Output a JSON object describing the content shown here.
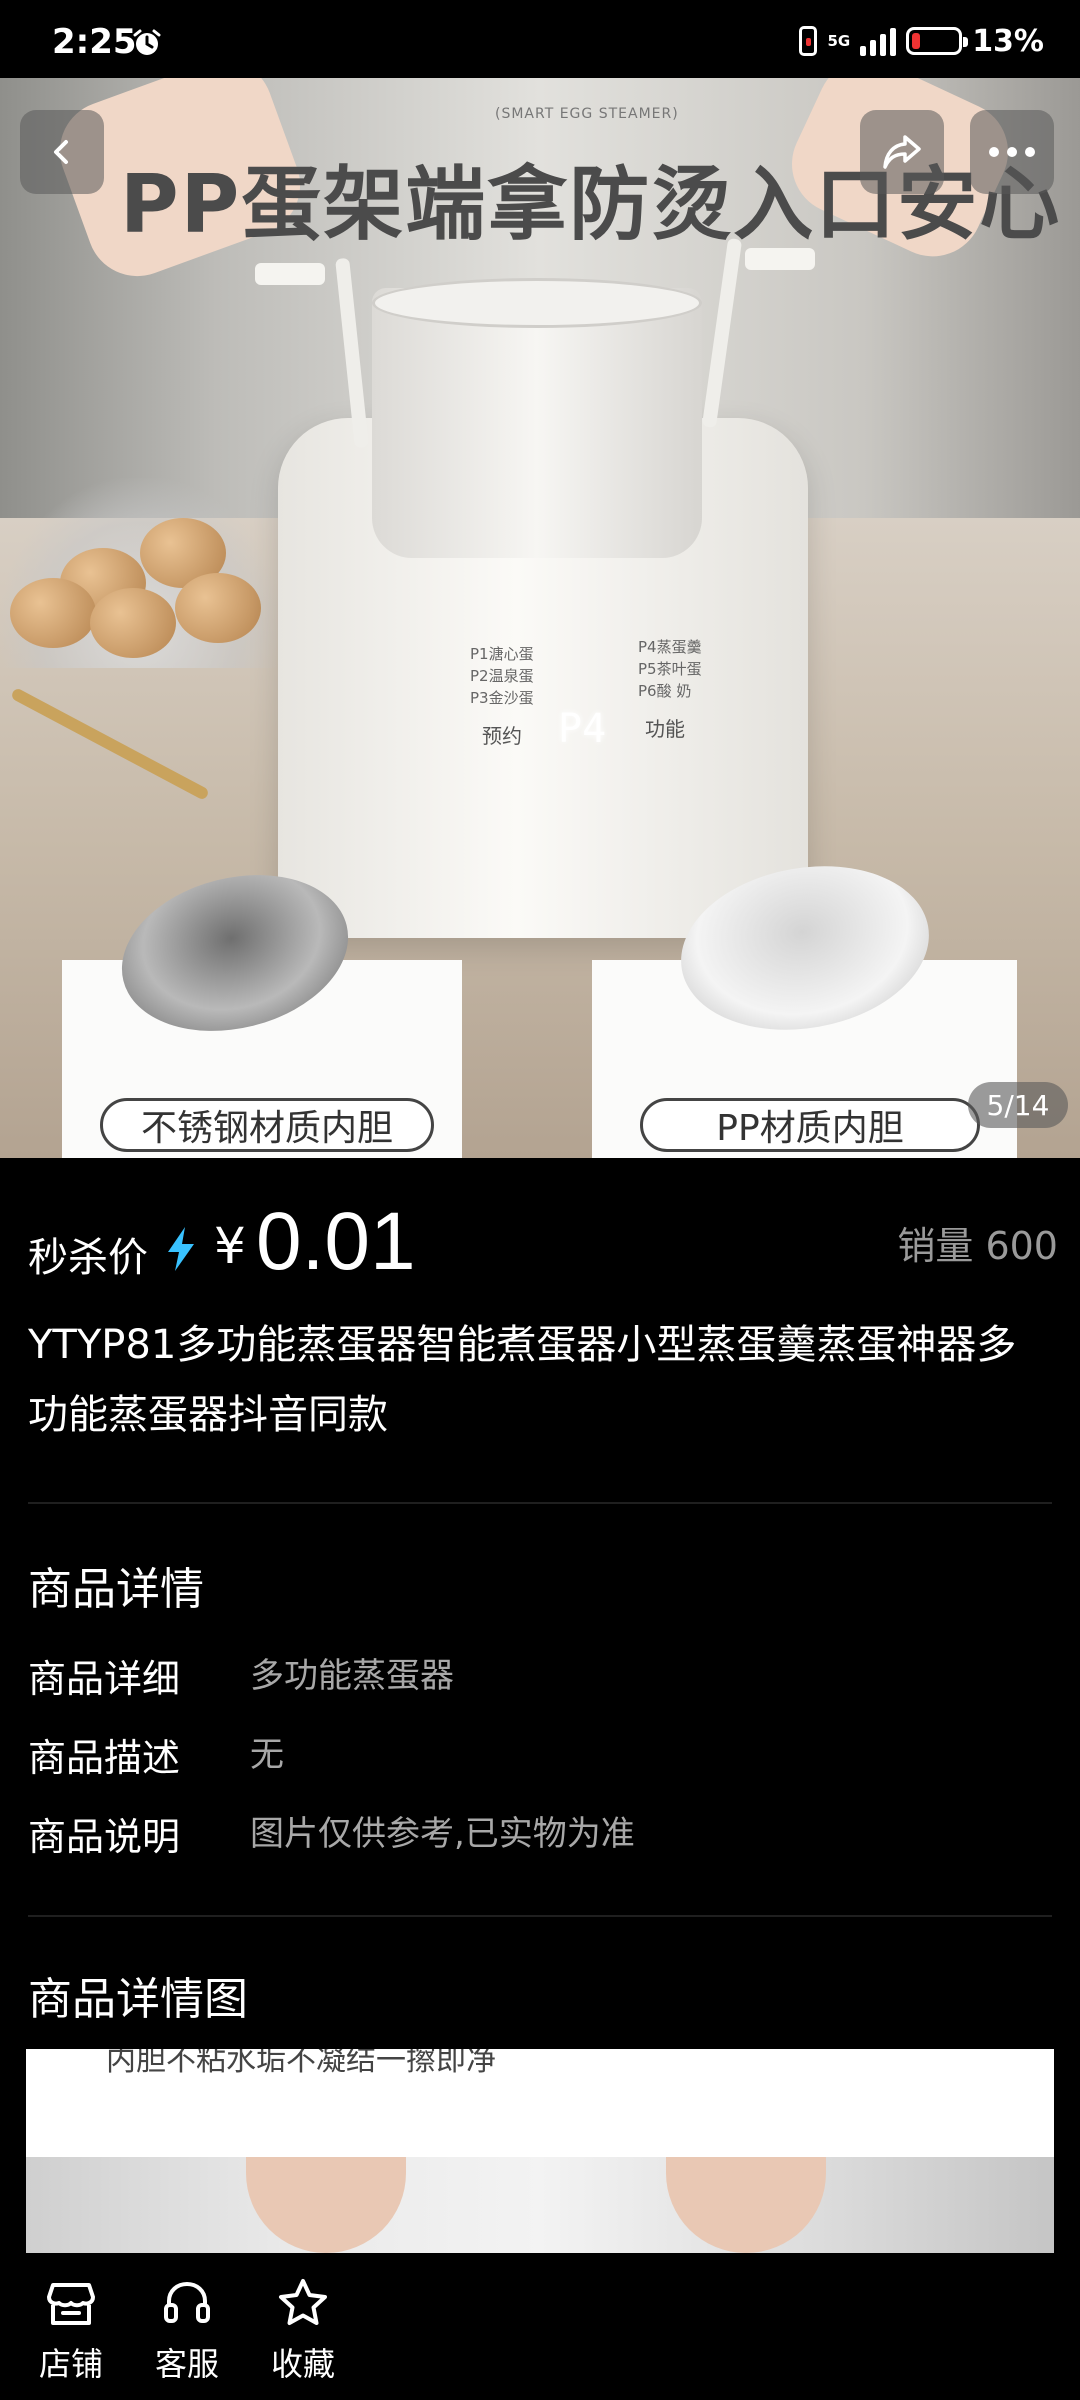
{
  "status_bar": {
    "time": "2:25",
    "network": "5G",
    "battery_percent": "13%",
    "icons": [
      "alarm-icon",
      "signal-icon",
      "battery-icon"
    ]
  },
  "gallery": {
    "headline": "PP蛋架端拿防烫入口安心",
    "small_caption": "(SMART EGG STEAMER)",
    "panel_left_lines": [
      "P1溏心蛋",
      "P2温泉蛋",
      "P3金沙蛋"
    ],
    "panel_right_lines": [
      "P4蒸蛋羹",
      "P5茶叶蛋",
      "P6酸 奶"
    ],
    "panel_button_left": "预约",
    "panel_button_right": "功能",
    "led_display": "P4",
    "card_left_label": "不锈钢材质内胆",
    "card_right_label": "PP材质内胆",
    "page_indicator": "5/14"
  },
  "product": {
    "price_label": "秒杀价",
    "currency": "¥",
    "price": "0.01",
    "sales_label": "销量 600",
    "title": " YTYP81多功能蒸蛋器智能煮蛋器小型蒸蛋羹蒸蛋神器多功能蒸蛋器抖音同款"
  },
  "details": {
    "section_title": "商品详情",
    "rows": [
      {
        "key": "商品详细",
        "value": "多功能蒸蛋器"
      },
      {
        "key": "商品描述",
        "value": "无"
      },
      {
        "key": "商品说明",
        "value": "图片仅供参考,已实物为准"
      }
    ]
  },
  "detail_images": {
    "section_title": "商品详情图",
    "caption": "内胆不粘水垢不凝结一擦即净"
  },
  "bottom_nav": {
    "items": [
      {
        "label": "店铺",
        "icon": "store-icon"
      },
      {
        "label": "客服",
        "icon": "headset-icon"
      },
      {
        "label": "收藏",
        "icon": "star-icon"
      }
    ]
  },
  "colors": {
    "background": "#000000",
    "accent_bolt": "#39c2ff",
    "muted_text": "#9a9a9a"
  }
}
